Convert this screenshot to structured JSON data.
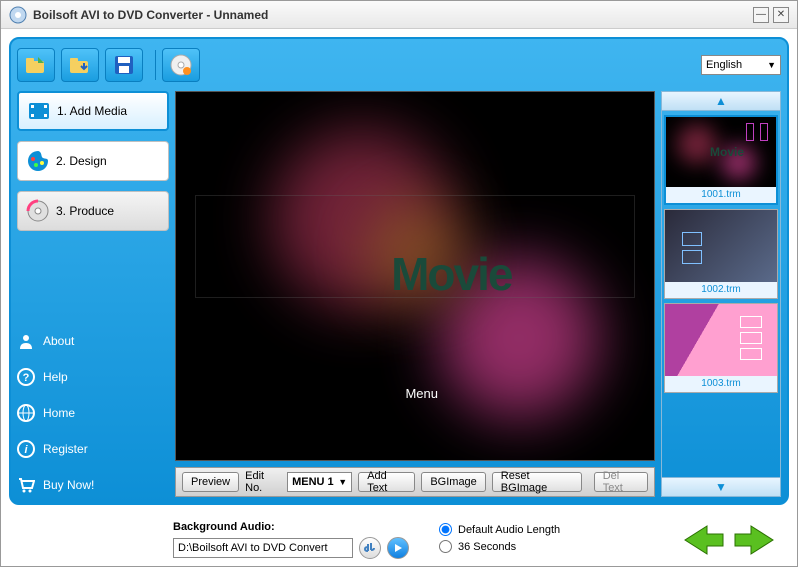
{
  "window": {
    "title": "Boilsoft AVI to DVD Converter  -  Unnamed"
  },
  "language": "English",
  "steps": {
    "add_media": "1. Add Media",
    "design": "2. Design",
    "produce": "3. Produce"
  },
  "sidebar_links": {
    "about": "About",
    "help": "Help",
    "home": "Home",
    "register": "Register",
    "buy_now": "Buy Now!"
  },
  "preview": {
    "movie_text": "Movie",
    "menu_text": "Menu"
  },
  "templates": [
    {
      "name": "1001.trm"
    },
    {
      "name": "1002.trm"
    },
    {
      "name": "1003.trm"
    }
  ],
  "controls": {
    "preview": "Preview",
    "edit_no": "Edit No.",
    "menu_select": "MENU 1",
    "add_text": "Add Text",
    "bgimage": "BGImage",
    "reset_bgimage": "Reset BGImage",
    "del_text": "Del Text"
  },
  "audio": {
    "label": "Background Audio:",
    "path": "D:\\Boilsoft AVI to DVD Convert",
    "radio_default": "Default Audio Length",
    "radio_seconds": "36 Seconds"
  }
}
